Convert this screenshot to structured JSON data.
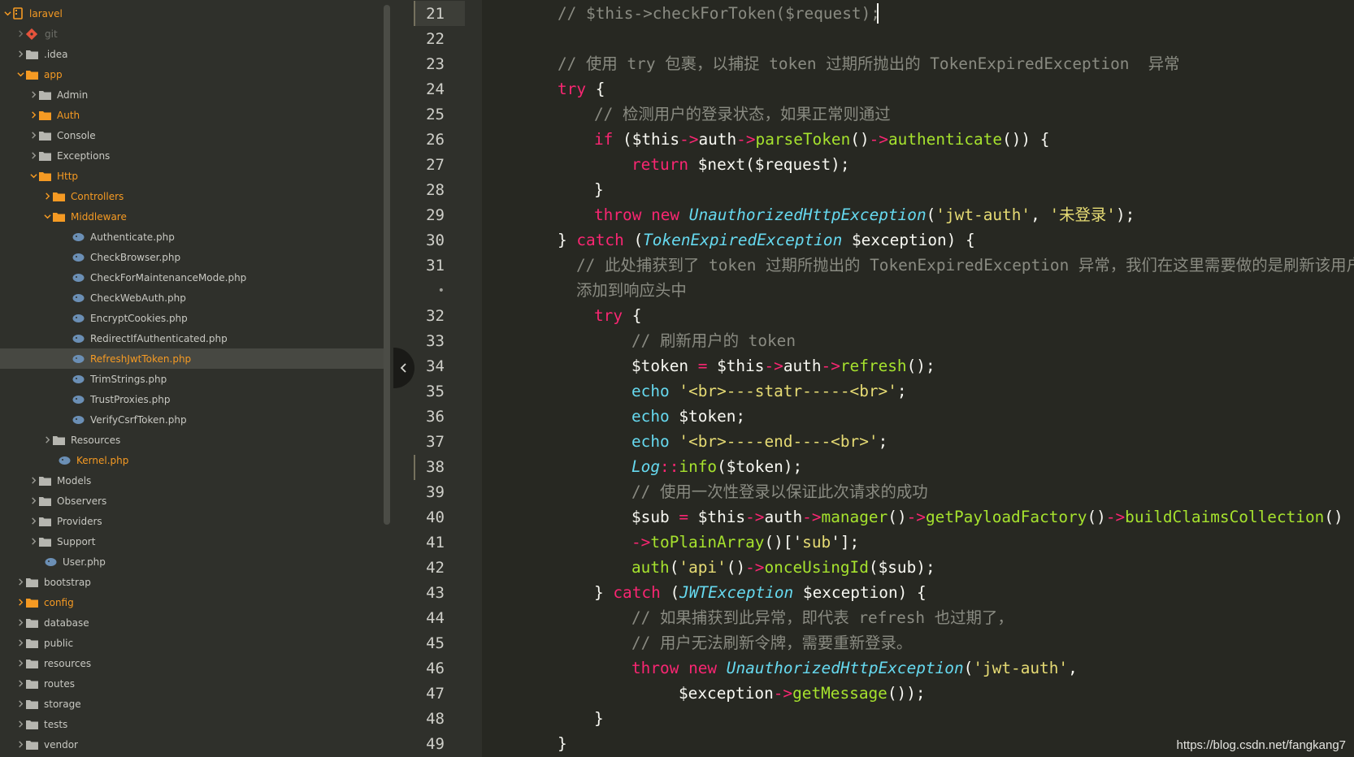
{
  "colors": {
    "background": "#272822",
    "sidebar": "#2f302b",
    "accent_folder": "#f59a23",
    "comment": "#8a8b82",
    "keyword": "#f92672",
    "function": "#a6e22e",
    "class": "#66d9ef",
    "string": "#e6db74"
  },
  "tree": {
    "root": "laravel",
    "git": "git",
    "idea": ".idea",
    "app": "app",
    "admin": "Admin",
    "auth": "Auth",
    "console": "Console",
    "exceptions": "Exceptions",
    "http": "Http",
    "controllers": "Controllers",
    "middleware": "Middleware",
    "mw_files": [
      "Authenticate.php",
      "CheckBrowser.php",
      "CheckForMaintenanceMode.php",
      "CheckWebAuth.php",
      "EncryptCookies.php",
      "RedirectIfAuthenticated.php",
      "RefreshJwtToken.php",
      "TrimStrings.php",
      "TrustProxies.php",
      "VerifyCsrfToken.php"
    ],
    "resources_sub": "Resources",
    "kernel": "Kernel.php",
    "models": "Models",
    "observers": "Observers",
    "providers": "Providers",
    "support": "Support",
    "user": "User.php",
    "bootstrap": "bootstrap",
    "config": "config",
    "database": "database",
    "public": "public",
    "resources": "resources",
    "routes": "routes",
    "storage": "storage",
    "tests": "tests",
    "vendor": "vendor"
  },
  "gutter": {
    "lines": [
      "21",
      "22",
      "23",
      "24",
      "25",
      "26",
      "27",
      "28",
      "29",
      "30",
      "31",
      "•",
      "32",
      "33",
      "34",
      "35",
      "36",
      "37",
      "38",
      "39",
      "40",
      "41",
      "42",
      "43",
      "44",
      "45",
      "46",
      "47",
      "48",
      "49"
    ]
  },
  "code": {
    "l21": "// $this->checkForToken($request);",
    "l23": "// 使用 try 包裹，以捕捉 token 过期所抛出的 TokenExpiredException  异常",
    "try": "try",
    "brace_open": " {",
    "l25": "// 检测用户的登录状态，如果正常则通过",
    "if": "if",
    "l26_a": " ($this",
    "arrow": "->",
    "auth": "auth",
    "parseToken": "parseToken",
    "authenticate": "authenticate",
    "l26_end": "()) {",
    "paren_close": "()",
    "return": "return",
    "l27_rest": " $next($request);",
    "brace_close": "}",
    "throw": "throw",
    "new": "new",
    "unauth": "UnauthorizedHttpException",
    "jwt_auth": "'jwt-auth'",
    "not_logged": "'未登录'",
    "l29_end": ");",
    "catch": "catch",
    "token_expired": "TokenExpiredException",
    "l30_end": " $exception) {",
    "l31_a": "// 此处捕获到了 token 过期所抛出的 TokenExpiredException 异常，我们在这里需要做的是刷新该用户的 token 并将它",
    "l31_b": "添加到响应头中",
    "l33": "// 刷新用户的 token",
    "l34_a": "$token",
    "eq": " = ",
    "l34_b": "$this",
    "refresh": "refresh",
    "l34_end": "();",
    "echo": "echo",
    "br_start": "'<br>---statr-----<br>'",
    "semi": ";",
    "l36_rest": " $token;",
    "br_end": "'<br>----end----<br>'",
    "log": "Log",
    "dcolon": "::",
    "info": "info",
    "l38_rest": "($token);",
    "l39": "// 使用一次性登录以保证此次请求的成功",
    "sub": "$sub",
    "manager": "manager",
    "getPayloadFactory": "getPayloadFactory",
    "buildClaimsCollection": "buildClaimsCollection",
    "toPlainArray": "toPlainArray",
    "l41_rest": "()['",
    "sub_key": "sub",
    "l41_end": "'];",
    "auth_fn": "auth",
    "api": "'api'",
    "onceUsingId": "onceUsingId",
    "l42_rest": "($sub);",
    "jwt_exc": "JWTException",
    "l44": "// 如果捕获到此异常，即代表 refresh 也过期了，",
    "l45": "// 用户无法刷新令牌，需要重新登录。",
    "open_paren": "(",
    "comma": ",",
    "l47_a": "$exception",
    "getMessage": "getMessage",
    "l47_end": "());"
  },
  "watermark": "https://blog.csdn.net/fangkang7"
}
